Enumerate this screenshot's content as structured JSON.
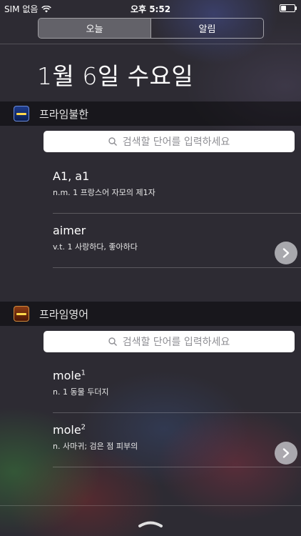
{
  "status": {
    "carrier": "SIM 없음",
    "time": "오후 5:52",
    "battery_level": 0.45
  },
  "tabs": [
    {
      "label": "오늘",
      "selected": true
    },
    {
      "label": "알림",
      "selected": false
    }
  ],
  "date": "1월 6일 수요일",
  "widgets": [
    {
      "title": "프라임불한",
      "icon": "dictionary-app-icon",
      "search_placeholder": "검색할 단어를 입력하세요",
      "entries": [
        {
          "word": "A1, a1",
          "sup": "",
          "definition": "n.m. 1 프랑스어 자모의 제1자"
        },
        {
          "word": "aimer",
          "sup": "",
          "definition": "v.t. 1 사랑하다, 좋아하다"
        }
      ]
    },
    {
      "title": "프라임영어",
      "icon": "dictionary-app-icon",
      "search_placeholder": "검색할 단어를 입력하세요",
      "entries": [
        {
          "word": "mole",
          "sup": "1",
          "definition": "n. 1 동물 두더지"
        },
        {
          "word": "mole",
          "sup": "2",
          "definition": "n.  사마귀; 검은 점 피부의"
        }
      ]
    }
  ]
}
